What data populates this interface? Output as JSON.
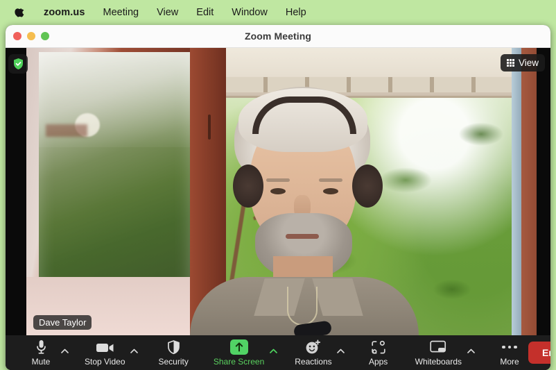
{
  "menubar": {
    "apple_icon": "apple-logo",
    "items": [
      {
        "label": "zoom.us",
        "bold": true
      },
      {
        "label": "Meeting",
        "bold": false
      },
      {
        "label": "View",
        "bold": false
      },
      {
        "label": "Edit",
        "bold": false
      },
      {
        "label": "Window",
        "bold": false
      },
      {
        "label": "Help",
        "bold": false
      }
    ],
    "background": "#bfe7a1"
  },
  "window": {
    "title": "Zoom Meeting",
    "traffic_lights": [
      "close",
      "minimize",
      "zoom"
    ],
    "colors": {
      "close": "#f0605b",
      "minimize": "#f5bd4f",
      "maximize": "#61c454"
    }
  },
  "stage": {
    "encryption_badge": {
      "icon": "shield-check-icon",
      "color": "#4fd15a"
    },
    "view_button": {
      "label": "View",
      "icon": "grid-view-icon"
    },
    "participant_name": "Dave Taylor"
  },
  "toolbar": {
    "background": "#1d1d1d",
    "items": [
      {
        "label": "Mute",
        "icon": "microphone-icon",
        "caret": true,
        "accent": "#e9e9e9"
      },
      {
        "label": "Stop Video",
        "icon": "video-camera-icon",
        "caret": true,
        "accent": "#e9e9e9"
      },
      {
        "label": "Security",
        "icon": "shield-icon",
        "caret": false,
        "accent": "#e9e9e9"
      },
      {
        "label": "Share Screen",
        "icon": "share-screen-up-arrow-icon",
        "caret": true,
        "accent": "#5ad15f"
      },
      {
        "label": "Reactions",
        "icon": "smiley-plus-icon",
        "caret": true,
        "accent": "#e9e9e9"
      },
      {
        "label": "Apps",
        "icon": "apps-bracket-icon",
        "caret": false,
        "accent": "#e9e9e9"
      },
      {
        "label": "Whiteboards",
        "icon": "whiteboard-icon",
        "caret": true,
        "accent": "#e9e9e9"
      },
      {
        "label": "More",
        "icon": "more-dots-icon",
        "caret": false,
        "accent": "#e9e9e9"
      }
    ],
    "end_button": {
      "label": "End",
      "color": "#c4302b"
    }
  }
}
